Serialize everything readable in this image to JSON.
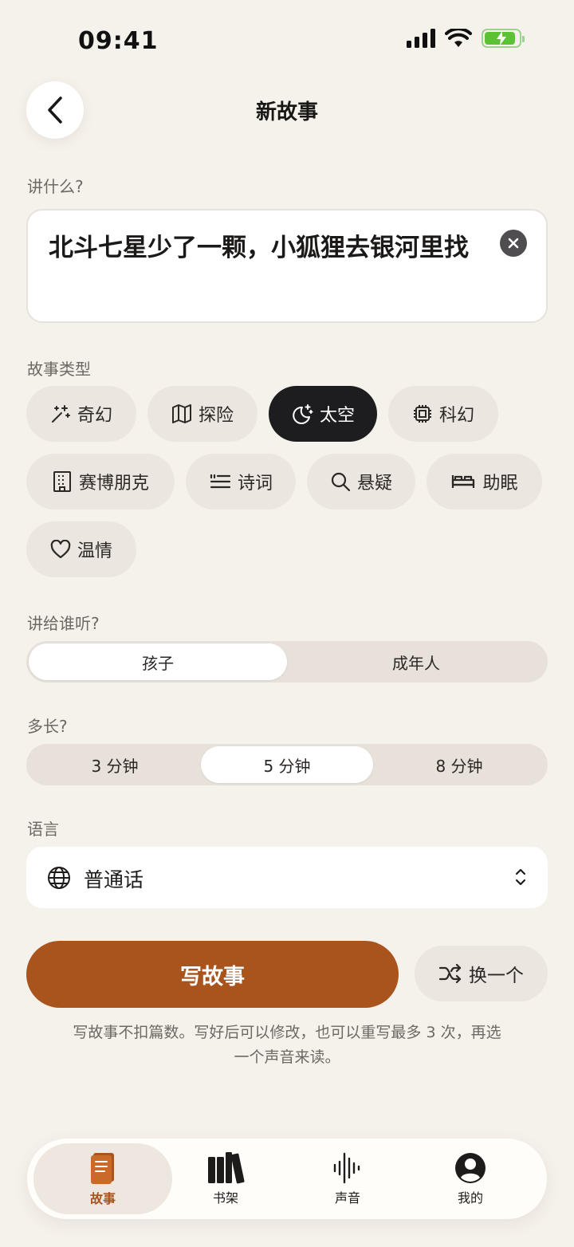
{
  "status": {
    "time": "09:41"
  },
  "header": {
    "title": "新故事"
  },
  "prompt": {
    "label": "讲什么?",
    "value": "北斗七星少了一颗，小狐狸去银河里找"
  },
  "genre": {
    "label": "故事类型",
    "chips": [
      {
        "label": "奇幻",
        "icon": "magic-wand-icon",
        "selected": false
      },
      {
        "label": "探险",
        "icon": "map-icon",
        "selected": false
      },
      {
        "label": "太空",
        "icon": "moon-stars-icon",
        "selected": true
      },
      {
        "label": "科幻",
        "icon": "chip-icon",
        "selected": false
      },
      {
        "label": "赛博朋克",
        "icon": "building-icon",
        "selected": false
      },
      {
        "label": "诗词",
        "icon": "quote-lines-icon",
        "selected": false
      },
      {
        "label": "悬疑",
        "icon": "search-icon",
        "selected": false
      },
      {
        "label": "助眠",
        "icon": "bed-icon",
        "selected": false
      },
      {
        "label": "温情",
        "icon": "heart-icon",
        "selected": false
      }
    ]
  },
  "audience": {
    "label": "讲给谁听?",
    "options": [
      "孩子",
      "成年人"
    ],
    "selected": "孩子"
  },
  "length": {
    "label": "多长?",
    "options": [
      "3 分钟",
      "5 分钟",
      "8 分钟"
    ],
    "selected": "5 分钟"
  },
  "language": {
    "label": "语言",
    "value": "普通话"
  },
  "actions": {
    "write": "写故事",
    "shuffle": "换一个",
    "note": "写故事不扣篇数。写好后可以修改，也可以重写最多 3 次，再选一个声音来读。"
  },
  "tabs": [
    {
      "label": "故事",
      "icon": "book-icon",
      "active": true
    },
    {
      "label": "书架",
      "icon": "bookshelf-icon",
      "active": false
    },
    {
      "label": "声音",
      "icon": "waveform-icon",
      "active": false
    },
    {
      "label": "我的",
      "icon": "profile-icon",
      "active": false
    }
  ],
  "colors": {
    "accent": "#a9531d",
    "background": "#f5f1eb",
    "chip": "#ece6e0",
    "selected_chip": "#1d1c1e"
  }
}
